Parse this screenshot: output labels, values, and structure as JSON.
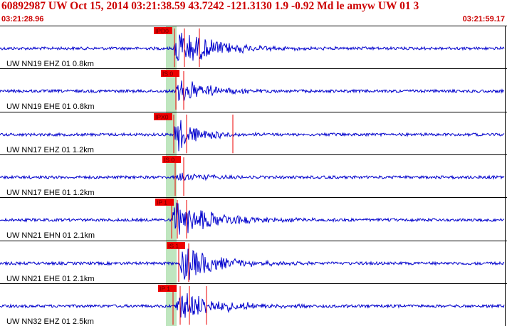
{
  "header": {
    "title": "60892987 UW Oct 15, 2014 03:21:38.59   43.7242 -121.3130  1.9 -0.92 Md le amyw UW 01   3",
    "start_time": "03:21:28.96",
    "end_time": "03:21:59.17"
  },
  "colors": {
    "trace": "#0000cc",
    "pick": "#ee0000",
    "window": "#bfe6bf",
    "header_text": "#cc0000",
    "grid": "#000000"
  },
  "traces": [
    {
      "label": "UW NN19 EHZ 01 0.8km",
      "pick_label": "IPD0",
      "amp": 1.0
    },
    {
      "label": "UW NN19 EHE 01 0.8km",
      "pick_label": "IS 0",
      "amp": 0.85
    },
    {
      "label": "UW NN17 EHZ 01 1.2km",
      "pick_label": "IPX0",
      "amp": 1.0
    },
    {
      "label": "UW NN17 EHE 01 1.2km",
      "pick_label": "IS 0",
      "amp": 0.6
    },
    {
      "label": "UW NN21 EHN 01 2.1km",
      "pick_label": "IP 1",
      "amp": 1.0
    },
    {
      "label": "UW NN21 EHE 01 2.1km",
      "pick_label": "IS 1",
      "amp": 1.0
    },
    {
      "label": "UW NN32 EHZ 01 2.5km",
      "pick_label": "IP 1",
      "amp": 1.0
    }
  ]
}
